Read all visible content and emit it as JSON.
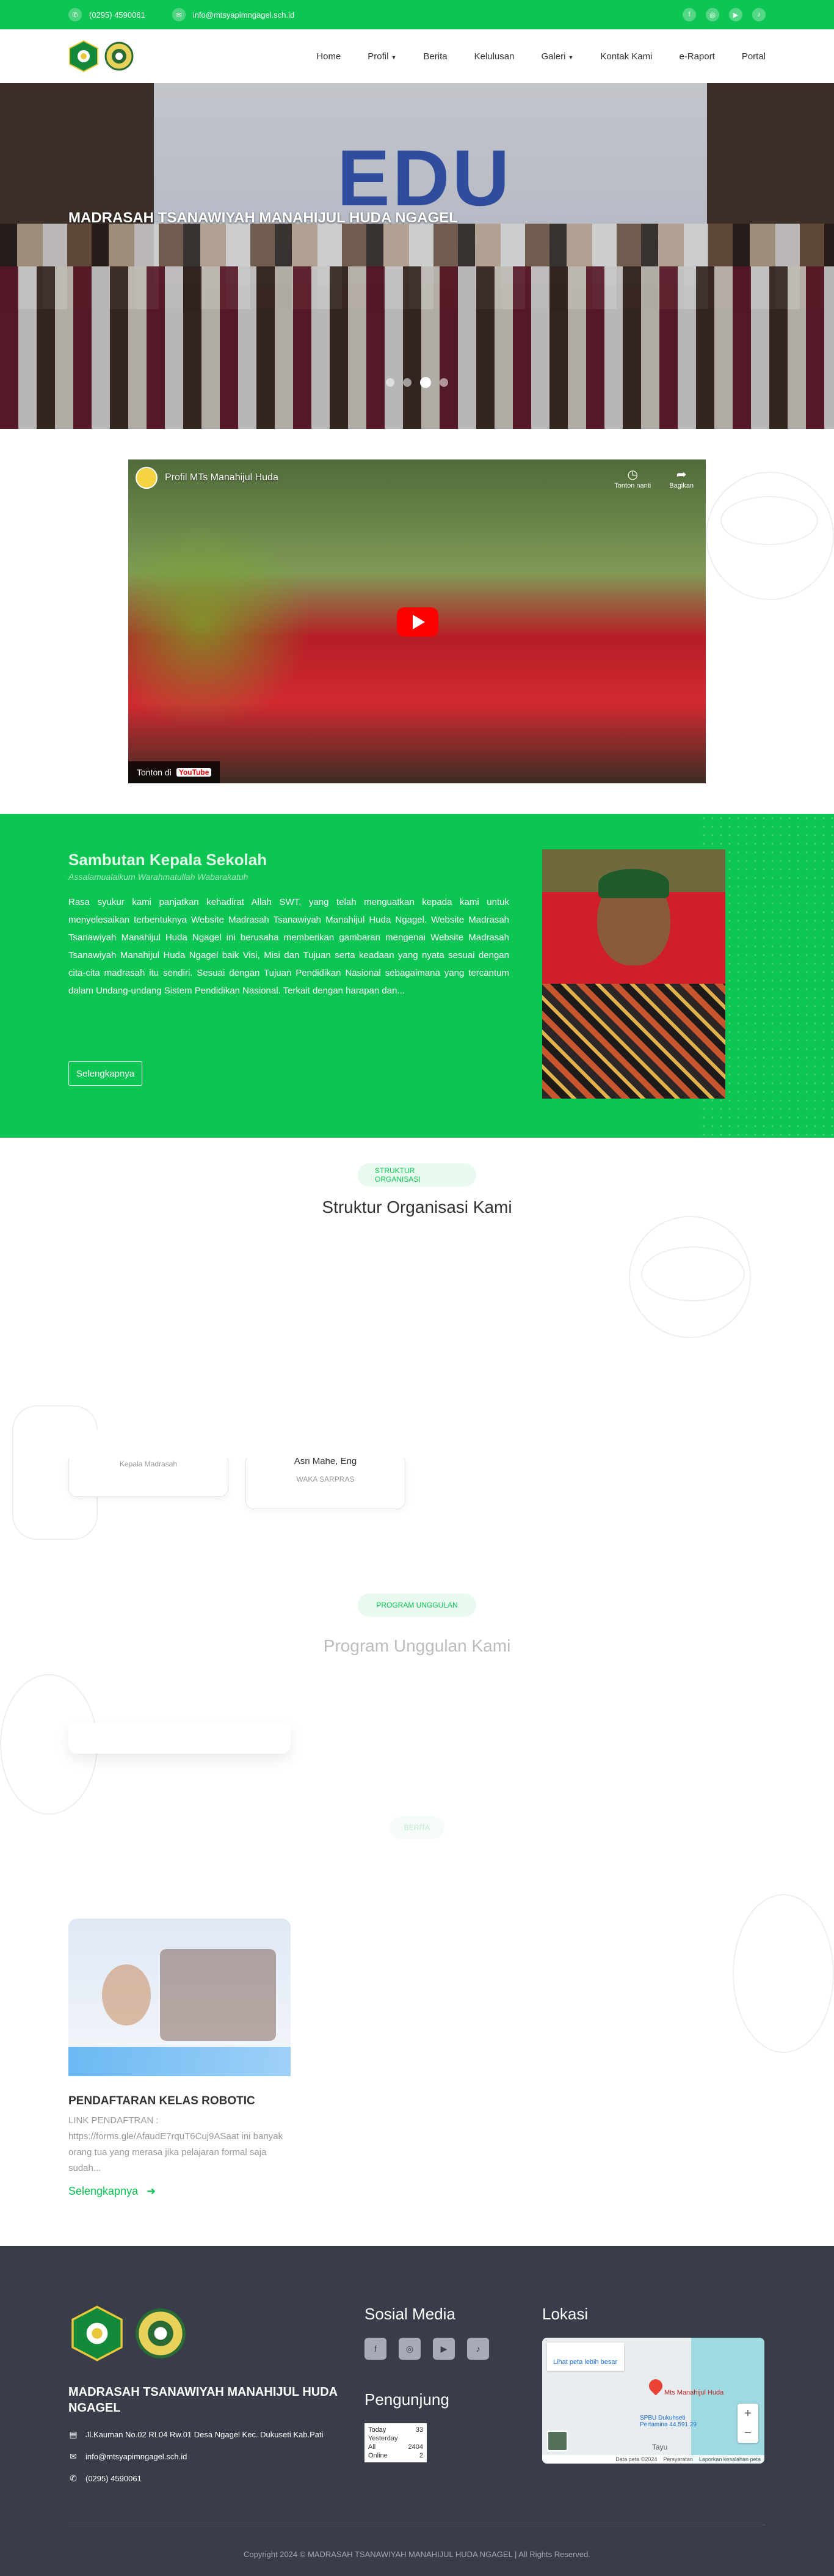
{
  "topbar": {
    "phone": "(0295) 4590061",
    "email": "info@mtsyapimngagel.sch.id",
    "socials": [
      "facebook-icon",
      "instagram-icon",
      "youtube-icon",
      "tiktok-icon"
    ]
  },
  "nav": {
    "items": [
      "Home",
      "Profil",
      "Berita",
      "Kelulusan",
      "Galeri",
      "Kontak Kami",
      "e-Raport",
      "Portal"
    ]
  },
  "hero": {
    "caption": "MADRASAH TSANAWIYAH MANAHIJUL HUDA NGAGEL",
    "banner_text": "EDU",
    "active_slide": 3,
    "slide_count": 4
  },
  "video": {
    "title": "Profil MTs Manahijul Huda",
    "watch_later": "Tonton nanti",
    "share": "Bagikan",
    "watch_on": "Tonton di",
    "yt_label": "YouTube"
  },
  "sambutan": {
    "title": "Sambutan Kepala Sekolah",
    "salam": "Assalamualaikum Warahmatullah Wabarakatuh",
    "text": "Rasa syukur kami panjatkan kehadirat Allah SWT, yang telah menguatkan kepada kami untuk menyelesaikan terbentuknya Website Madrasah Tsanawiyah Manahijul Huda Ngagel. Website Madrasah Tsanawiyah Manahijul Huda Ngagel ini berusaha memberikan gambaran mengenai Website Madrasah Tsanawiyah Manahijul Huda Ngagel baik Visi, Misi dan Tujuan serta keadaan yang nyata sesuai dengan cita-cita madrasah itu sendiri. Sesuai dengan Tujuan Pendidikan Nasional sebagaimana yang tercantum dalam Undang-undang Sistem Pendidikan Nasional. Terkait dengan harapan dan...",
    "button": "Selengkapnya"
  },
  "struktur": {
    "badge": "STRUKTUR ORGANISASI",
    "title": "Struktur Organisasi Kami",
    "cards": [
      {
        "name": "",
        "role": "Kepala Madrasah"
      },
      {
        "name": "Asri Mahe, Eng",
        "role": "WAKA SARPRAS"
      }
    ]
  },
  "program": {
    "badge": "PROGRAM UNGGULAN",
    "title": "Program Unggulan Kami"
  },
  "berita": {
    "badge": "BERITA",
    "card": {
      "title": "PENDAFTARAN KELAS ROBOTIC",
      "excerpt": "LINK PENDAFTRAN : https://forms.gle/AfaudE7rquT6Cuj9ASaat ini banyak orang tua yang merasa jika pelajaran formal saja sudah...",
      "more": "Selengkapnya"
    }
  },
  "footer": {
    "school": "MADRASAH TSANAWIYAH MANAHIJUL HUDA NGAGEL",
    "address": "Jl.Kauman No.02 RL04 Rw.01 Desa Ngagel Kec. Dukuseti Kab.Pati",
    "email": "info@mtsyapimngagel.sch.id",
    "phone": "(0295) 4590061",
    "social_title": "Sosial Media",
    "visitor_title": "Pengunjung",
    "location_title": "Lokasi",
    "counter": [
      {
        "label": "Today",
        "value": "33"
      },
      {
        "label": "Yesterday",
        "value": ""
      },
      {
        "label": "All",
        "value": "2404"
      },
      {
        "label": "Online",
        "value": "2"
      }
    ],
    "map": {
      "place": "Mts Manahijul Huda",
      "link": "Lihat peta lebih besar",
      "pin_label": "Mts Manahijul Huda",
      "poi": "SPBU Dukuhseti Pertamina 44.591.29",
      "town": "Tayu",
      "attribution": [
        "Data peta ©2024",
        "Persyaratan",
        "Laporkan kesalahan peta"
      ]
    },
    "copyright": "Copyright 2024 © MADRASAH TSANAWIYAH MANAHIJUL HUDA NGAGEL | All Rights Reserved."
  },
  "colors": {
    "brand_green": "#0cc552",
    "footer_bg": "#383d49"
  }
}
